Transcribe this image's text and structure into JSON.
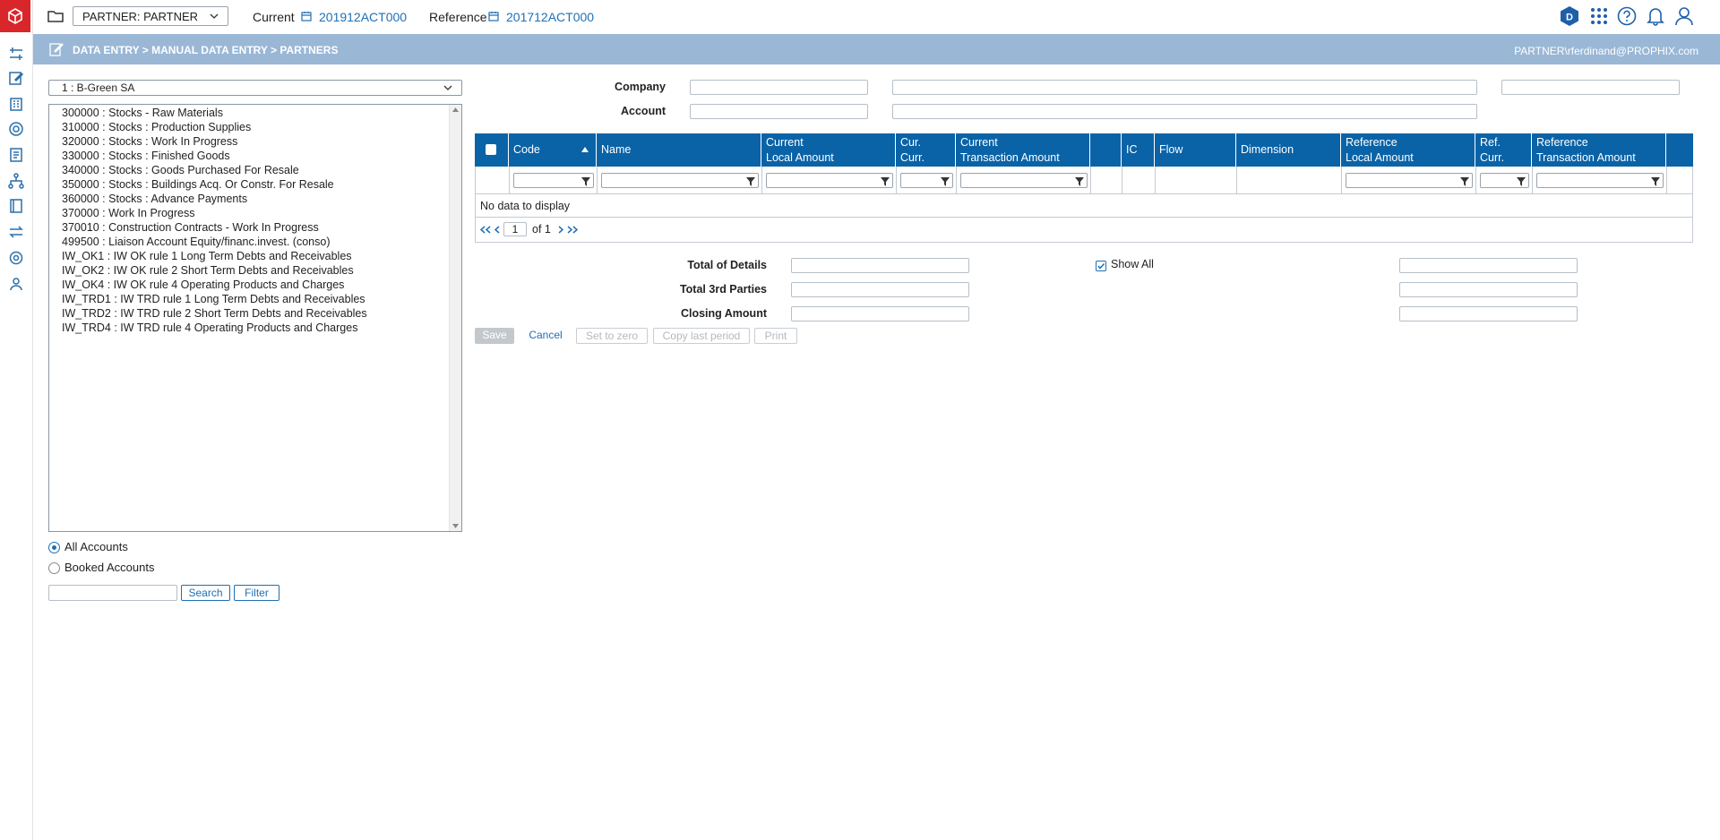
{
  "topbar": {
    "partner_select": "PARTNER: PARTNER",
    "current_label": "Current",
    "current_value": "201912ACT000",
    "reference_label": "Reference",
    "reference_value": "201712ACT000",
    "badge_letter": "D"
  },
  "breadcrumb": {
    "path": "DATA ENTRY > MANUAL DATA ENTRY > PARTNERS",
    "user": "PARTNER\\rferdinand@PROPHIX.com"
  },
  "left": {
    "entity_select": "1 : B-Green SA",
    "accounts": [
      "300000 : Stocks - Raw Materials",
      "310000 : Stocks : Production Supplies",
      "320000 : Stocks : Work In Progress",
      "330000 : Stocks : Finished Goods",
      "340000 : Stocks : Goods Purchased For Resale",
      "350000 : Stocks : Buildings Acq. Or Constr. For Resale",
      "360000 : Stocks : Advance Payments",
      "370000 : Work In Progress",
      "370010 : Construction Contracts - Work In Progress",
      "499500 : Liaison Account Equity/financ.invest. (conso)",
      "IW_OK1 : IW OK rule 1 Long Term Debts and Receivables",
      "IW_OK2 : IW OK rule 2 Short Term Debts and Receivables",
      "IW_OK4 : IW OK rule 4 Operating Products and Charges",
      "IW_TRD1 : IW TRD rule 1 Long Term Debts and Receivables",
      "IW_TRD2 : IW TRD rule 2 Short Term Debts and Receivables",
      "IW_TRD4 : IW TRD rule 4 Operating Products and Charges"
    ],
    "radio_all": "All Accounts",
    "radio_booked": "Booked Accounts",
    "search_label": "Search",
    "filter_label": "Filter"
  },
  "form": {
    "company_label": "Company",
    "account_label": "Account"
  },
  "grid": {
    "columns": [
      {
        "line1": "Code",
        "line2": ""
      },
      {
        "line1": "Name",
        "line2": ""
      },
      {
        "line1": "Current",
        "line2": "Local Amount"
      },
      {
        "line1": "Cur.",
        "line2": "Curr."
      },
      {
        "line1": "Current",
        "line2": "Transaction Amount"
      },
      {
        "line1": "",
        "line2": ""
      },
      {
        "line1": "IC",
        "line2": ""
      },
      {
        "line1": "Flow",
        "line2": ""
      },
      {
        "line1": "Dimension",
        "line2": ""
      },
      {
        "line1": "Reference",
        "line2": "Local Amount"
      },
      {
        "line1": "Ref.",
        "line2": "Curr."
      },
      {
        "line1": "Reference",
        "line2": "Transaction Amount"
      }
    ],
    "no_data": "No data to display",
    "page_value": "1",
    "page_of": "of 1"
  },
  "totals": {
    "total_details": "Total of Details",
    "total_3rd": "Total 3rd Parties",
    "closing": "Closing Amount",
    "show_all": "Show All"
  },
  "actions": {
    "save": "Save",
    "cancel": "Cancel",
    "set_zero": "Set to zero",
    "copy_last": "Copy last period",
    "print": "Print"
  },
  "colors": {
    "brand_red": "#d9262b",
    "grid_header": "#0a63a7",
    "breadcrumb_bar": "#9ab7d6",
    "link_blue": "#1f6fb5"
  }
}
